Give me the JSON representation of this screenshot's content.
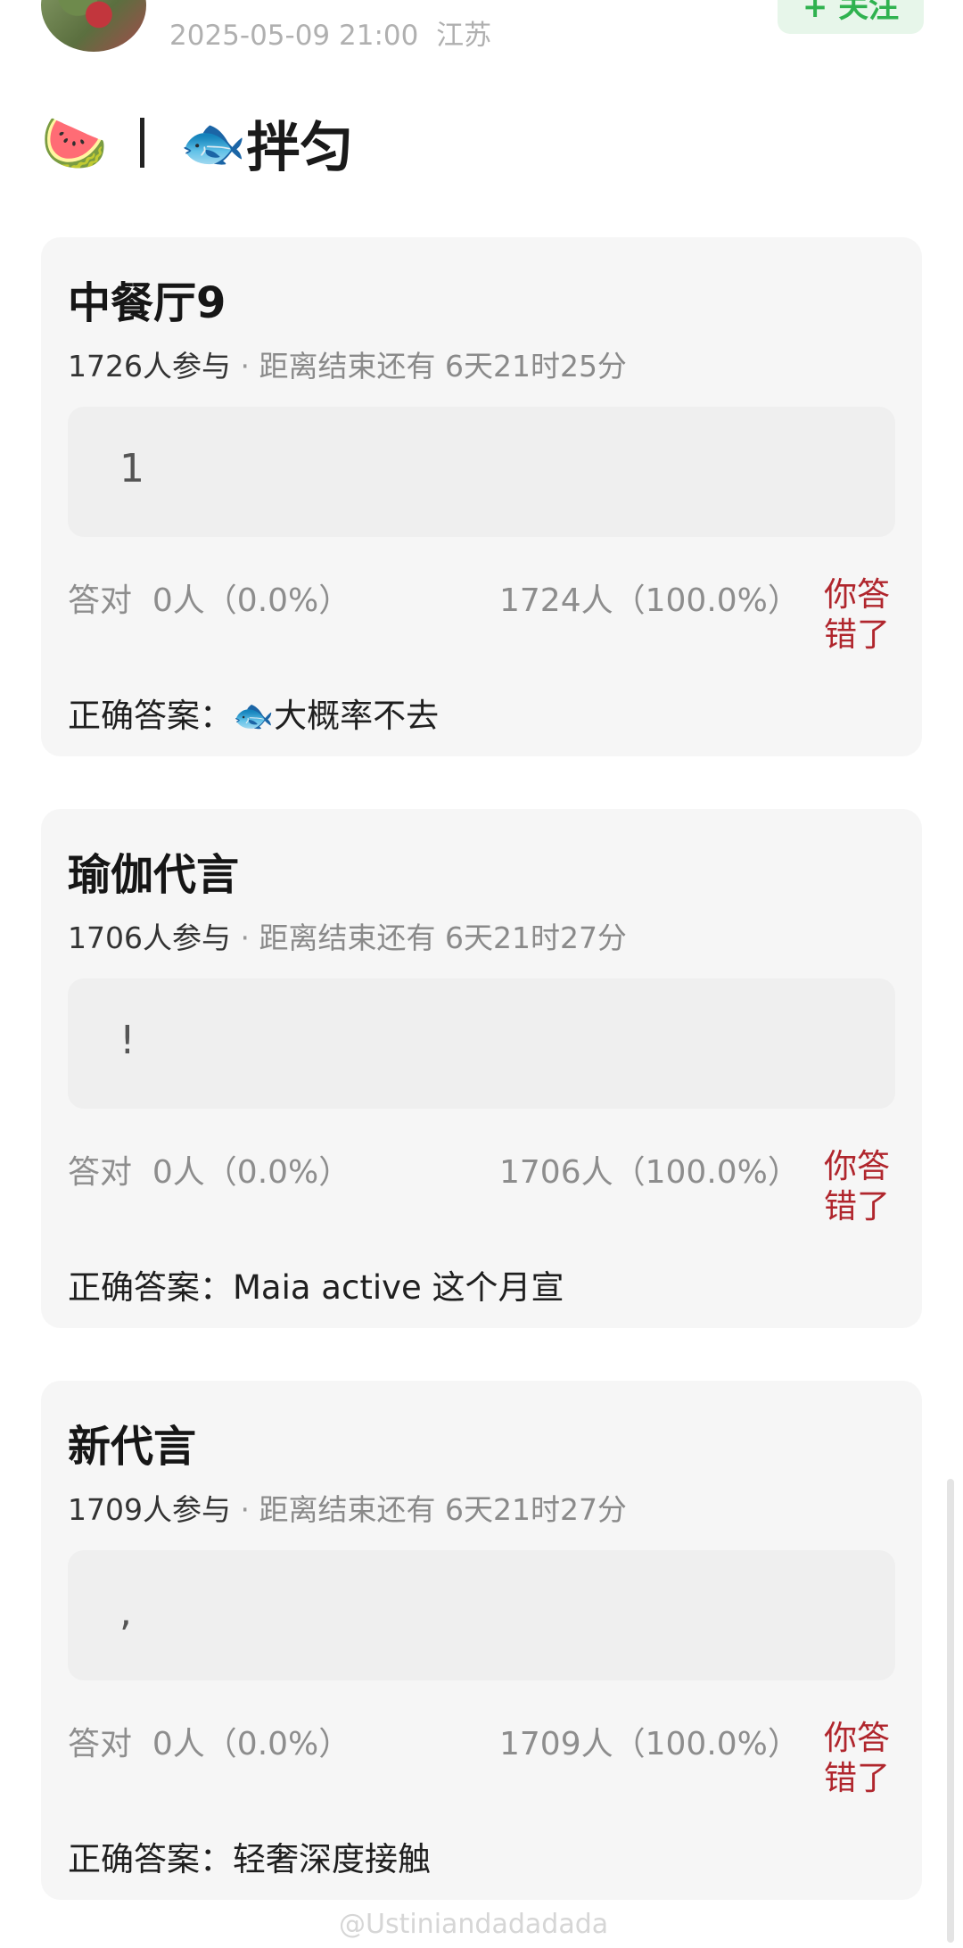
{
  "header": {
    "timestamp": "2025-05-09 21:00",
    "location": "江苏",
    "follow_label": "+ 关注"
  },
  "post": {
    "title_emoji_1": "🍉",
    "title_emoji_2": "🐟",
    "title_text": "拌匀"
  },
  "polls": [
    {
      "title": "中餐厅9",
      "participants": "1726人参与",
      "countdown": "距离结束还有 6天21时25分",
      "option_text": "1",
      "correct_result": "答对  0人（0.0%）",
      "wrong_result": "1724人（100.0%）",
      "wrong_tag": "你答错了",
      "answer_label": "正确答案：",
      "answer_value": "🐟大概率不去"
    },
    {
      "title": "瑜伽代言",
      "participants": "1706人参与",
      "countdown": "距离结束还有 6天21时27分",
      "option_text": "!",
      "correct_result": "答对  0人（0.0%）",
      "wrong_result": "1706人（100.0%）",
      "wrong_tag": "你答错了",
      "answer_label": "正确答案：",
      "answer_value": "Maia active 这个月宣"
    },
    {
      "title": "新代言",
      "participants": "1709人参与",
      "countdown": "距离结束还有 6天21时27分",
      "option_text": ",",
      "correct_result": "答对  0人（0.0%）",
      "wrong_result": "1709人（100.0%）",
      "wrong_tag": "你答错了",
      "answer_label": "正确答案：",
      "answer_value": "轻奢深度接触"
    }
  ],
  "watermark": "@Ustiniandadadada",
  "colors": {
    "card_bg": "#f6f6f6",
    "option_bg": "#efefef",
    "wrong_red": "#b0262d",
    "follow_green": "#2fb24f"
  }
}
